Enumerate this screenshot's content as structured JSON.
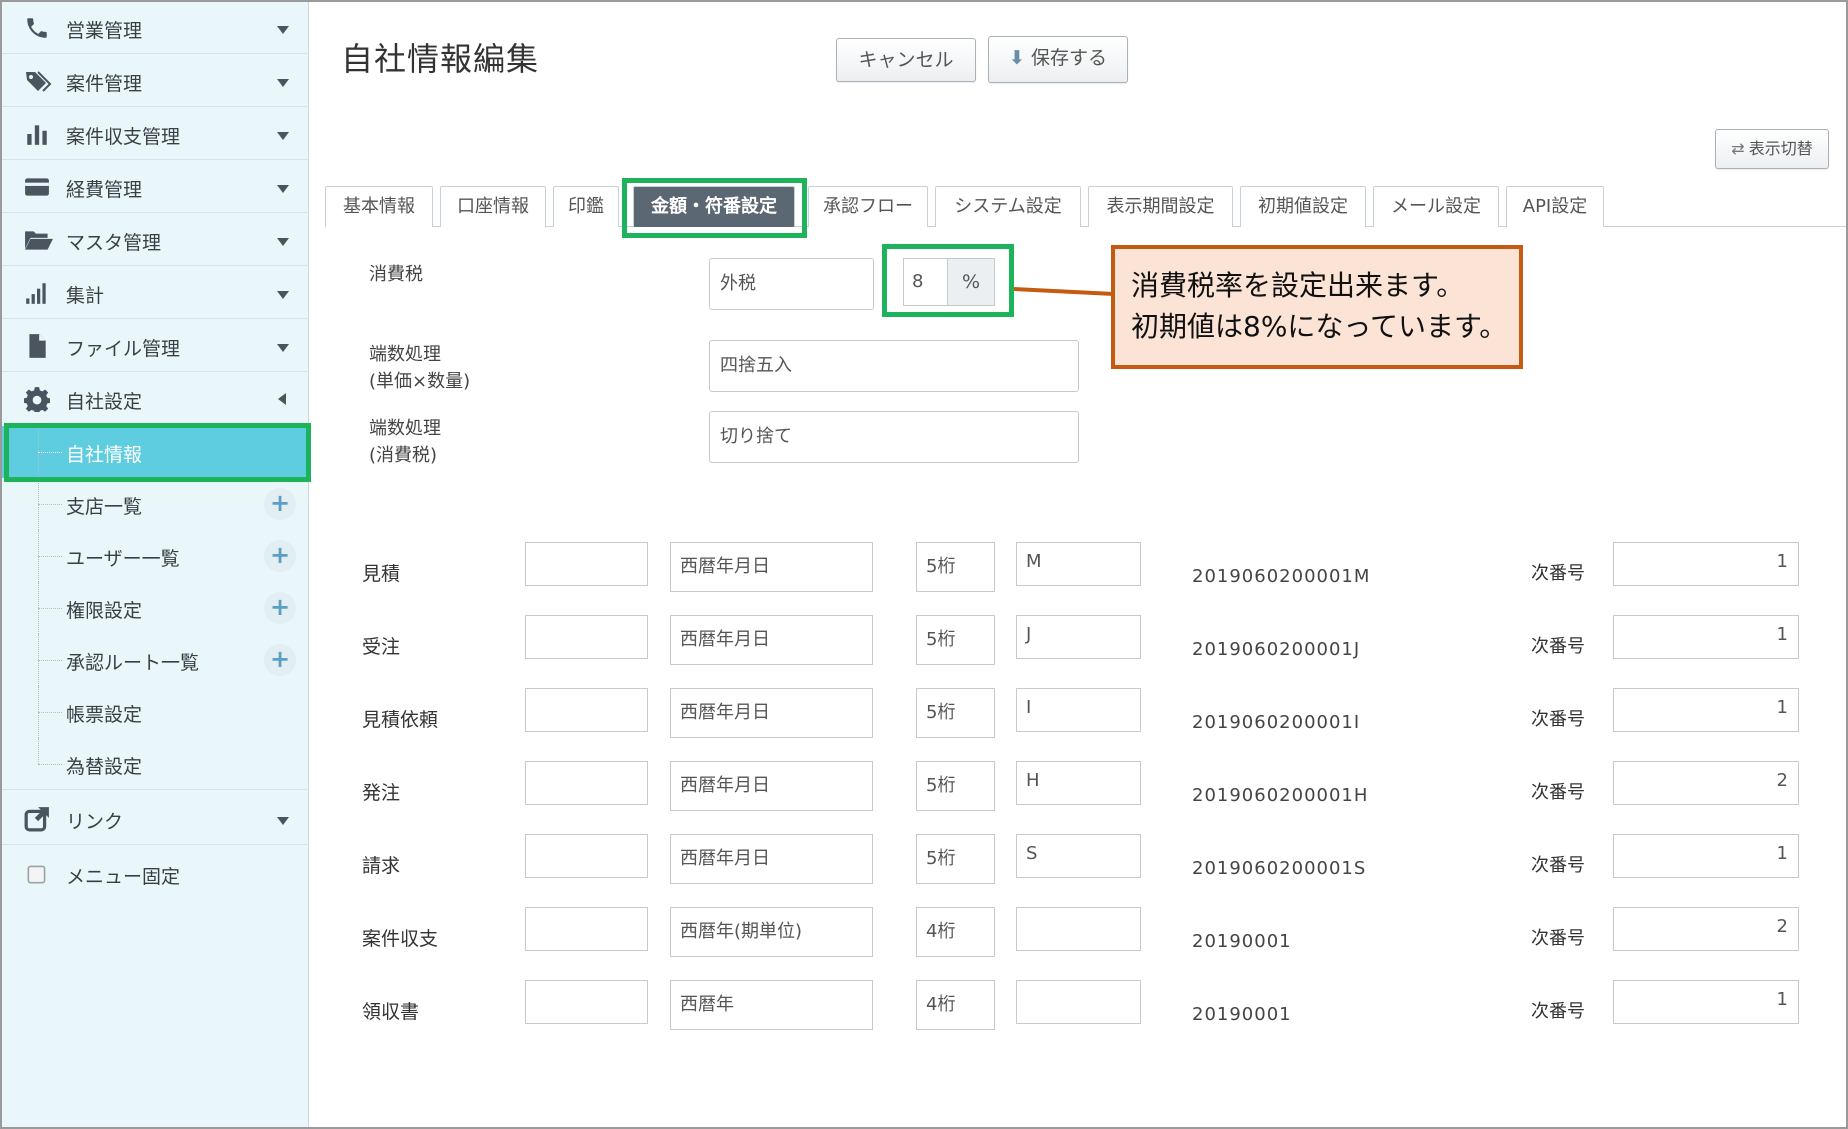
{
  "sidebar": {
    "items": [
      {
        "label": "営業管理"
      },
      {
        "label": "案件管理"
      },
      {
        "label": "案件収支管理"
      },
      {
        "label": "経費管理"
      },
      {
        "label": "マスタ管理"
      },
      {
        "label": "集計"
      },
      {
        "label": "ファイル管理"
      },
      {
        "label": "自社設定"
      }
    ],
    "sub_items": [
      {
        "label": "自社情報"
      },
      {
        "label": "支店一覧"
      },
      {
        "label": "ユーザー一覧"
      },
      {
        "label": "権限設定"
      },
      {
        "label": "承認ルート一覧"
      },
      {
        "label": "帳票設定"
      },
      {
        "label": "為替設定"
      }
    ],
    "link": {
      "label": "リンク"
    },
    "menu_fixed": {
      "label": "メニュー固定"
    }
  },
  "header": {
    "title": "自社情報編集",
    "cancel_label": "キャンセル",
    "save_label": "保存する",
    "view_toggle_label": "表示切替"
  },
  "tabs": [
    {
      "label": "基本情報"
    },
    {
      "label": "口座情報"
    },
    {
      "label": "印鑑"
    },
    {
      "label": "金額・符番設定"
    },
    {
      "label": "承認フロー"
    },
    {
      "label": "システム設定"
    },
    {
      "label": "表示期間設定"
    },
    {
      "label": "初期値設定"
    },
    {
      "label": "メール設定"
    },
    {
      "label": "API設定"
    }
  ],
  "form": {
    "tax_label": "消費税",
    "tax_type": "外税",
    "tax_rate": "8",
    "tax_unit": "%",
    "rounding_unit_label_1": "端数処理",
    "rounding_unit_label_2": "(単価×数量)",
    "rounding_unit_value": "四捨五入",
    "rounding_tax_label_1": "端数処理",
    "rounding_tax_label_2": "(消費税)",
    "rounding_tax_value": "切り捨て"
  },
  "callout": {
    "line1": "消費税率を設定出来ます。",
    "line2": "初期値は8%になっています。"
  },
  "numbering": {
    "next_label": "次番号",
    "rows": [
      {
        "label": "見積",
        "prefix": "",
        "format": "西暦年月日",
        "digits": "5桁",
        "suffix": "M",
        "example": "2019060200001M",
        "next": "1"
      },
      {
        "label": "受注",
        "prefix": "",
        "format": "西暦年月日",
        "digits": "5桁",
        "suffix": "J",
        "example": "2019060200001J",
        "next": "1"
      },
      {
        "label": "見積依頼",
        "prefix": "",
        "format": "西暦年月日",
        "digits": "5桁",
        "suffix": "I",
        "example": "2019060200001I",
        "next": "1"
      },
      {
        "label": "発注",
        "prefix": "",
        "format": "西暦年月日",
        "digits": "5桁",
        "suffix": "H",
        "example": "2019060200001H",
        "next": "2"
      },
      {
        "label": "請求",
        "prefix": "",
        "format": "西暦年月日",
        "digits": "5桁",
        "suffix": "S",
        "example": "2019060200001S",
        "next": "1"
      },
      {
        "label": "案件収支",
        "prefix": "",
        "format": "西暦年(期単位)",
        "digits": "4桁",
        "suffix": "",
        "example": "20190001",
        "next": "2"
      },
      {
        "label": "領収書",
        "prefix": "",
        "format": "西暦年",
        "digits": "4桁",
        "suffix": "",
        "example": "20190001",
        "next": "1"
      }
    ]
  },
  "colors": {
    "highlight": "#1db35a",
    "active_tab": "#5b6773",
    "active_sidebar": "#5ecde0",
    "callout_border": "#c55a11",
    "callout_bg": "#fbe4d6"
  }
}
